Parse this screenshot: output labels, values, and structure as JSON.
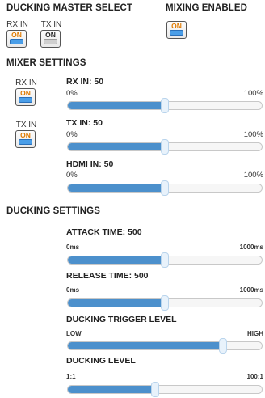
{
  "ducking_master_select": {
    "title": "DUCKING MASTER SELECT",
    "rx": {
      "caption": "RX IN",
      "state": "ON",
      "on": true
    },
    "tx": {
      "caption": "TX IN",
      "state": "ON",
      "on": false
    }
  },
  "mixing_enabled": {
    "title": "MIXING ENABLED",
    "state": "ON",
    "on": true
  },
  "mixer_settings": {
    "title": "MIXER SETTINGS",
    "rx_toggle": {
      "caption": "RX IN",
      "state": "ON"
    },
    "tx_toggle": {
      "caption": "TX IN",
      "state": "ON"
    },
    "sliders": [
      {
        "label": "RX IN: 50",
        "min": "0%",
        "max": "100%",
        "value": 50,
        "range": [
          0,
          100
        ]
      },
      {
        "label": "TX IN: 50",
        "min": "0%",
        "max": "100%",
        "value": 50,
        "range": [
          0,
          100
        ]
      },
      {
        "label": "HDMI IN: 50",
        "min": "0%",
        "max": "100%",
        "value": 50,
        "range": [
          0,
          100
        ]
      }
    ]
  },
  "ducking_settings": {
    "title": "DUCKING SETTINGS",
    "sliders": [
      {
        "label": "ATTACK TIME: 500",
        "min": "0ms",
        "max": "1000ms",
        "value": 500,
        "range": [
          0,
          1000
        ]
      },
      {
        "label": "RELEASE TIME: 500",
        "min": "0ms",
        "max": "1000ms",
        "value": 500,
        "range": [
          0,
          1000
        ]
      },
      {
        "label": "DUCKING TRIGGER LEVEL",
        "min": "LOW",
        "max": "HIGH",
        "fraction": 0.8
      },
      {
        "label": "DUCKING LEVEL",
        "min": "1:1",
        "max": "100:1",
        "fraction": 0.45
      }
    ]
  },
  "colors": {
    "accent": "#4c90cc",
    "on_text": "#e07a00",
    "on_bar": "#4a9ee8"
  }
}
